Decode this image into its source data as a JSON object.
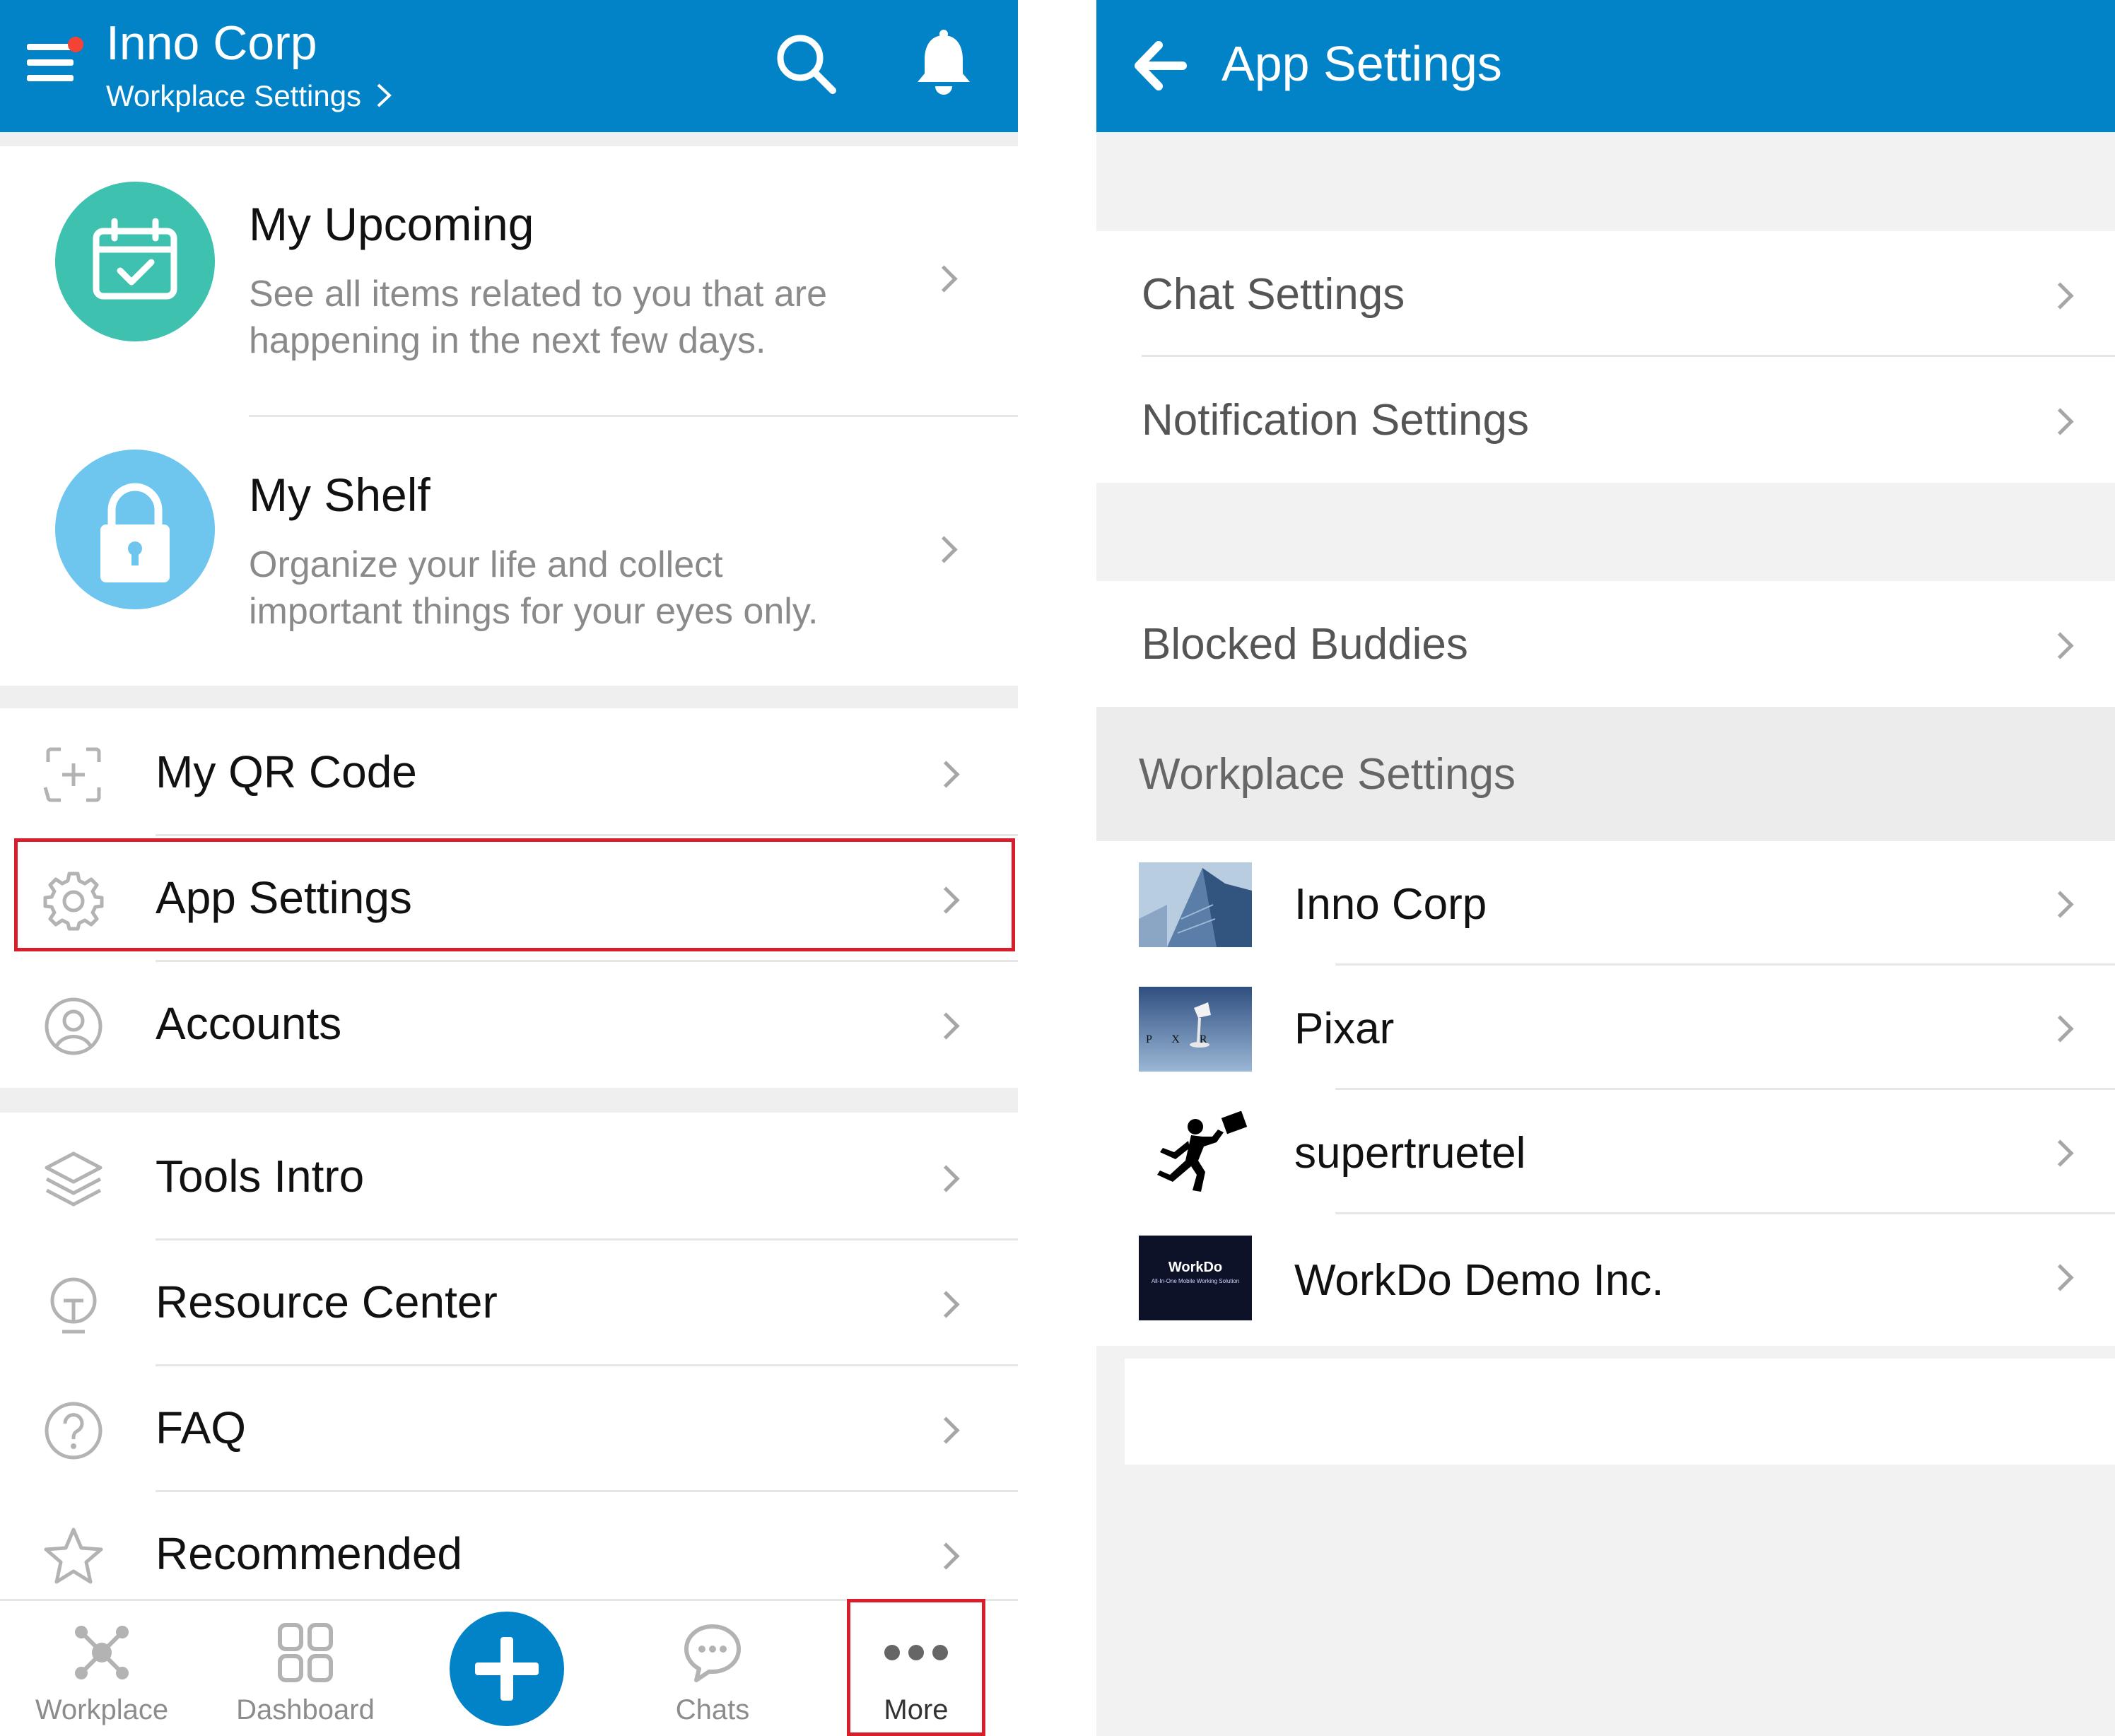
{
  "left": {
    "header": {
      "org_name": "Inno Corp",
      "subtitle": "Workplace Settings",
      "subtitle_chevron": ">",
      "menu_icon": "hamburger-menu-icon",
      "search_icon": "search-icon",
      "bell_icon": "bell-icon"
    },
    "features": [
      {
        "title": "My Upcoming",
        "desc_line1": "See all items related to you that are",
        "desc_line2": "happening in the next few days.",
        "icon": "calendar-check-icon",
        "color": "#3fc1b0"
      },
      {
        "title": "My Shelf",
        "desc_line1": "Organize your life and collect",
        "desc_line2": "important things for your eyes only.",
        "icon": "lock-icon",
        "color": "#6ec6ef"
      }
    ],
    "menu": [
      {
        "label": "My QR Code",
        "icon": "qr-scan-icon"
      },
      {
        "label": "App Settings",
        "icon": "gear-icon"
      },
      {
        "label": "Accounts",
        "icon": "user-circle-icon"
      },
      {
        "label": "Tools Intro",
        "icon": "layers-icon"
      },
      {
        "label": "Resource Center",
        "icon": "lightbulb-icon"
      },
      {
        "label": "FAQ",
        "icon": "question-circle-icon"
      },
      {
        "label": "Recommended",
        "icon": "star-icon"
      }
    ],
    "bottom_nav": [
      {
        "label": "Workplace",
        "icon": "network-icon"
      },
      {
        "label": "Dashboard",
        "icon": "grid-icon"
      },
      {
        "label": "",
        "icon": "plus-icon"
      },
      {
        "label": "Chats",
        "icon": "chat-bubble-icon"
      },
      {
        "label": "More",
        "icon": "more-dots-icon"
      }
    ],
    "accent_color": "#0283c7",
    "highlight_color": "#d81e2a"
  },
  "right": {
    "header": {
      "title": "App Settings",
      "back_icon": "back-arrow-icon"
    },
    "group1": [
      "Chat Settings",
      "Notification Settings"
    ],
    "group2": [
      "Blocked Buddies"
    ],
    "section_title": "Workplace Settings",
    "workplaces": [
      {
        "name": "Inno Corp",
        "thumb": "skyscraper-thumbnail"
      },
      {
        "name": "Pixar",
        "thumb": "pixar-lamp-thumbnail",
        "thumb_text": "P  X  R"
      },
      {
        "name": "supertruetel",
        "thumb": "running-man-thumbnail"
      },
      {
        "name": "WorkDo Demo Inc.",
        "thumb": "workdo-thumbnail",
        "thumb_text": "WorkDo",
        "thumb_sub": "All-In-One Mobile Working Solution"
      }
    ]
  }
}
